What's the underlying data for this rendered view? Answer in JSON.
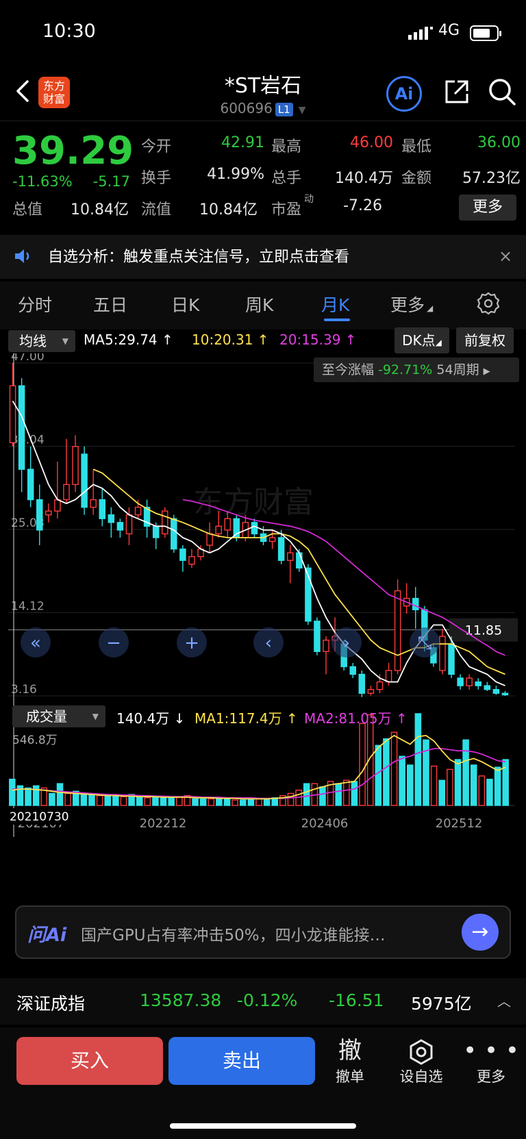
{
  "status_bar": {
    "time": "10:30",
    "network": "4G"
  },
  "header": {
    "logo_line1": "东方",
    "logo_line2": "财富",
    "title": "*ST岩石",
    "code": "600696",
    "level_badge": "L1",
    "ai_label": "Ai"
  },
  "quote": {
    "price": "39.29",
    "change_pct": "-11.63%",
    "change": "-5.17",
    "rows": [
      [
        {
          "label": "今开",
          "value": "42.91",
          "color": "green"
        },
        {
          "label": "最高",
          "value": "46.00",
          "color": "red"
        },
        {
          "label": "最低",
          "value": "36.00",
          "color": "green"
        }
      ],
      [
        {
          "label": "换手",
          "value": "41.99%",
          "color": "white"
        },
        {
          "label": "总手",
          "value": "140.4万",
          "color": "white"
        },
        {
          "label": "金额",
          "value": "57.23亿",
          "color": "white"
        }
      ],
      [
        {
          "label": "总值",
          "value": "10.84亿",
          "color": "white"
        },
        {
          "label": "流值",
          "value": "10.84亿",
          "color": "white"
        },
        {
          "label": "市盈",
          "value": "-7.26",
          "color": "white",
          "sup": "动"
        }
      ]
    ],
    "more_button": "更多"
  },
  "notice": {
    "text": "自选分析：触发重点关注信号，立即点击查看",
    "close": "×"
  },
  "tabs": [
    "分时",
    "五日",
    "日K",
    "周K",
    "月K",
    "更多"
  ],
  "active_tab": 4,
  "indicator_bar": {
    "selector": "均线",
    "ma5": "MA5:29.74",
    "ma10": "10:20.31",
    "ma20": "20:15.39",
    "dk_button": "DK点",
    "adjust_button": "前复权",
    "since_label": "至今涨幅",
    "since_value": "-92.71%",
    "periods": "54周期"
  },
  "volume_bar": {
    "selector": "成交量",
    "current": "140.4万",
    "ma1": "MA1:117.4万",
    "ma2": "MA2:81.05万",
    "max_label": "546.8万"
  },
  "chart_data": {
    "type": "candlestick",
    "y_ticks": [
      "47.00",
      "36.04",
      "25.08",
      "14.12",
      "3.16"
    ],
    "ylim": [
      3.16,
      47.0
    ],
    "last_price_label": "11.85",
    "x_ticks": [
      "202107",
      "202212",
      "202406",
      "202512"
    ],
    "crosshair_date": "20210730",
    "watermark": "东方财富",
    "candles": [
      {
        "o": 36.5,
        "c": 44.0,
        "h": 47.0,
        "l": 36.0
      },
      {
        "o": 44.0,
        "c": 33.0,
        "h": 45.0,
        "l": 30.0
      },
      {
        "o": 33.0,
        "c": 29.0,
        "h": 36.0,
        "l": 28.0
      },
      {
        "o": 29.0,
        "c": 25.0,
        "h": 31.0,
        "l": 23.0
      },
      {
        "o": 27.0,
        "c": 27.5,
        "h": 28.5,
        "l": 26.0
      },
      {
        "o": 27.5,
        "c": 29.0,
        "h": 34.0,
        "l": 26.5
      },
      {
        "o": 29.0,
        "c": 31.0,
        "h": 37.0,
        "l": 28.5
      },
      {
        "o": 31.0,
        "c": 36.0,
        "h": 37.5,
        "l": 30.0
      },
      {
        "o": 35.0,
        "c": 28.0,
        "h": 36.0,
        "l": 27.0
      },
      {
        "o": 28.0,
        "c": 29.0,
        "h": 33.0,
        "l": 27.0
      },
      {
        "o": 29.0,
        "c": 26.5,
        "h": 30.5,
        "l": 25.5
      },
      {
        "o": 27.0,
        "c": 26.0,
        "h": 28.0,
        "l": 24.0
      },
      {
        "o": 26.0,
        "c": 25.0,
        "h": 26.5,
        "l": 24.0
      },
      {
        "o": 24.5,
        "c": 27.0,
        "h": 28.0,
        "l": 23.0
      },
      {
        "o": 27.0,
        "c": 28.0,
        "h": 29.0,
        "l": 26.5
      },
      {
        "o": 28.0,
        "c": 25.5,
        "h": 29.0,
        "l": 24.0
      },
      {
        "o": 25.5,
        "c": 24.0,
        "h": 26.0,
        "l": 22.5
      },
      {
        "o": 24.5,
        "c": 27.5,
        "h": 28.0,
        "l": 24.0
      },
      {
        "o": 26.5,
        "c": 22.5,
        "h": 27.0,
        "l": 22.0
      },
      {
        "o": 22.5,
        "c": 21.0,
        "h": 23.0,
        "l": 19.5
      },
      {
        "o": 20.5,
        "c": 21.5,
        "h": 22.5,
        "l": 20.0
      },
      {
        "o": 21.5,
        "c": 22.5,
        "h": 23.0,
        "l": 21.0
      },
      {
        "o": 23.0,
        "c": 24.5,
        "h": 26.0,
        "l": 22.0
      },
      {
        "o": 24.5,
        "c": 25.5,
        "h": 27.5,
        "l": 24.0
      },
      {
        "o": 25.0,
        "c": 26.5,
        "h": 27.5,
        "l": 24.0
      },
      {
        "o": 26.5,
        "c": 24.0,
        "h": 27.0,
        "l": 23.5
      },
      {
        "o": 24.0,
        "c": 26.0,
        "h": 27.0,
        "l": 23.5
      },
      {
        "o": 26.0,
        "c": 24.5,
        "h": 26.5,
        "l": 24.0
      },
      {
        "o": 24.5,
        "c": 23.5,
        "h": 25.5,
        "l": 23.0
      },
      {
        "o": 23.5,
        "c": 24.0,
        "h": 25.0,
        "l": 22.5
      },
      {
        "o": 24.0,
        "c": 21.0,
        "h": 25.0,
        "l": 20.5
      },
      {
        "o": 21.0,
        "c": 22.0,
        "h": 23.0,
        "l": 18.0
      },
      {
        "o": 22.0,
        "c": 20.0,
        "h": 22.5,
        "l": 19.5
      },
      {
        "o": 20.0,
        "c": 13.0,
        "h": 20.5,
        "l": 12.5
      },
      {
        "o": 13.0,
        "c": 9.0,
        "h": 13.5,
        "l": 8.5
      },
      {
        "o": 9.0,
        "c": 10.5,
        "h": 11.0,
        "l": 6.0
      },
      {
        "o": 10.5,
        "c": 11.0,
        "h": 13.5,
        "l": 9.0
      },
      {
        "o": 10.0,
        "c": 7.0,
        "h": 10.5,
        "l": 6.5
      },
      {
        "o": 7.0,
        "c": 6.0,
        "h": 7.5,
        "l": 5.5
      },
      {
        "o": 6.0,
        "c": 3.5,
        "h": 6.5,
        "l": 3.0
      },
      {
        "o": 3.5,
        "c": 4.0,
        "h": 4.5,
        "l": 3.2
      },
      {
        "o": 4.0,
        "c": 5.0,
        "h": 6.0,
        "l": 3.5
      },
      {
        "o": 5.0,
        "c": 6.5,
        "h": 7.5,
        "l": 4.5
      },
      {
        "o": 6.5,
        "c": 17.0,
        "h": 18.5,
        "l": 6.0
      },
      {
        "o": 15.0,
        "c": 16.0,
        "h": 18.0,
        "l": 14.0
      },
      {
        "o": 16.0,
        "c": 14.5,
        "h": 17.5,
        "l": 12.0
      },
      {
        "o": 14.5,
        "c": 10.5,
        "h": 15.0,
        "l": 9.0
      },
      {
        "o": 9.5,
        "c": 7.5,
        "h": 10.0,
        "l": 7.0
      },
      {
        "o": 6.5,
        "c": 11.0,
        "h": 12.0,
        "l": 6.0
      },
      {
        "o": 10.0,
        "c": 6.0,
        "h": 11.0,
        "l": 5.5
      },
      {
        "o": 5.5,
        "c": 4.5,
        "h": 6.0,
        "l": 4.0
      },
      {
        "o": 4.5,
        "c": 5.5,
        "h": 6.0,
        "l": 4.0
      },
      {
        "o": 5.0,
        "c": 4.5,
        "h": 5.5,
        "l": 4.0
      },
      {
        "o": 4.5,
        "c": 4.0,
        "h": 5.0,
        "l": 3.8
      },
      {
        "o": 4.0,
        "c": 3.5,
        "h": 4.5,
        "l": 3.3
      },
      {
        "o": 3.5,
        "c": 3.3,
        "h": 3.8,
        "l": 3.16
      }
    ],
    "ma5": [
      42,
      40,
      37,
      34,
      31,
      29,
      28.5,
      29,
      30,
      31,
      30.5,
      29.5,
      28,
      27,
      26.5,
      26,
      25.5,
      25.5,
      25,
      24,
      23.5,
      22.5,
      22,
      22.5,
      23.5,
      24.5,
      25,
      25.5,
      25,
      25,
      24.5,
      23.5,
      22,
      19,
      16,
      13.5,
      11.5,
      10,
      9,
      8,
      6.5,
      5.5,
      5,
      5,
      7.5,
      9.5,
      11,
      12.5,
      12.5,
      10.5,
      8.5,
      7,
      6.5,
      6,
      5,
      4.5
    ],
    "ma10": [
      null,
      null,
      null,
      null,
      null,
      null,
      null,
      null,
      null,
      33,
      32.5,
      31.5,
      30.5,
      29.5,
      28.5,
      27.8,
      27.2,
      26.8,
      26.4,
      26,
      25.5,
      25,
      24.5,
      24.2,
      24,
      24,
      24,
      24,
      24,
      24.5,
      24.5,
      24.2,
      23.5,
      22.5,
      20.5,
      18.5,
      16.5,
      15,
      13.5,
      12,
      10.5,
      9.5,
      9,
      8.5,
      9,
      9.5,
      9.5,
      10,
      10,
      10,
      9.5,
      9,
      8,
      7,
      6.5,
      6
    ],
    "ma20": [
      null,
      null,
      null,
      null,
      null,
      null,
      null,
      null,
      null,
      null,
      null,
      null,
      null,
      null,
      null,
      null,
      null,
      null,
      null,
      29,
      28.8,
      28.5,
      28.2,
      27.8,
      27.4,
      27,
      26.6,
      26.3,
      26.1,
      25.9,
      25.7,
      25.5,
      25.2,
      24.8,
      24.2,
      23.5,
      22.5,
      21.5,
      20.5,
      19.5,
      18.5,
      17.5,
      16.5,
      16,
      15.5,
      15,
      14.5,
      14,
      13.5,
      12.8,
      12,
      11.3,
      10.5,
      9.8,
      9,
      8.5
    ],
    "volume": [
      48,
      36,
      32,
      36,
      32,
      22,
      40,
      22,
      26,
      20,
      20,
      18,
      20,
      18,
      16,
      20,
      18,
      14,
      16,
      14,
      14,
      16,
      18,
      12,
      12,
      12,
      14,
      12,
      10,
      10,
      12,
      12,
      12,
      14,
      18,
      22,
      28,
      40,
      40,
      34,
      44,
      40,
      46,
      44,
      150,
      166,
      110,
      122,
      134,
      90,
      74,
      168,
      120,
      72,
      46,
      66,
      84,
      120,
      74,
      54,
      48,
      70,
      84
    ],
    "volume_up": [
      false,
      false,
      false,
      false,
      true,
      false,
      false,
      true,
      false,
      false,
      false,
      true,
      false,
      false,
      true,
      false,
      false,
      true,
      false,
      false,
      false,
      true,
      true,
      false,
      false,
      true,
      false,
      false,
      true,
      false,
      false,
      true,
      false,
      false,
      true,
      true,
      true,
      false,
      true,
      false,
      true,
      false,
      true,
      false,
      true,
      true,
      false,
      false,
      true,
      false,
      false,
      false,
      false,
      true,
      false,
      true,
      false,
      false,
      false,
      true,
      false,
      false,
      false
    ],
    "vol_ma1": [
      28,
      30,
      30,
      29,
      28,
      26,
      24,
      23,
      22,
      21,
      20,
      19,
      18,
      18,
      17,
      17,
      16,
      16,
      16,
      15,
      15,
      15,
      15,
      14,
      14,
      14,
      13,
      13,
      13,
      12,
      12,
      12,
      12,
      13,
      14,
      16,
      20,
      25,
      30,
      34,
      38,
      40,
      42,
      44,
      62,
      88,
      106,
      118,
      128,
      120,
      112,
      126,
      128,
      118,
      100,
      84,
      76,
      82,
      86,
      80,
      72,
      64,
      70
    ],
    "vol_ma2": [
      30,
      30,
      30,
      29,
      28,
      27,
      26,
      25,
      24,
      23,
      22,
      21,
      20,
      20,
      19,
      19,
      18,
      18,
      17,
      17,
      16,
      16,
      16,
      16,
      15,
      15,
      15,
      14,
      14,
      14,
      14,
      13,
      13,
      13,
      13,
      14,
      15,
      17,
      19,
      21,
      24,
      26,
      28,
      30,
      38,
      50,
      60,
      70,
      80,
      86,
      90,
      96,
      100,
      104,
      104,
      102,
      100,
      100,
      98,
      94,
      88,
      82,
      80
    ]
  },
  "chart_controls": [
    "«",
    "−",
    "+",
    "‹",
    "›",
    "⤡"
  ],
  "ai_bar": {
    "logo": "问Ai",
    "text": "国产GPU占有率冲击50%，四小龙谁能接…",
    "go": "→"
  },
  "index_bar": {
    "name": "深证成指",
    "value": "13587.38",
    "pct": "-0.12%",
    "change": "-16.51",
    "amount": "5975亿"
  },
  "bottom_bar": {
    "buy": "买入",
    "sell": "卖出",
    "cancel_icon": "撤",
    "cancel": "撤单",
    "watch": "设自选",
    "more": "更多"
  },
  "colors": {
    "up": "#ff3b3b",
    "down": "#2ee0e6",
    "ma5": "#ffffff",
    "ma10": "#ffe14a",
    "ma20": "#d22ad2",
    "accent": "#3d84ff",
    "green": "#2ecb3f"
  }
}
